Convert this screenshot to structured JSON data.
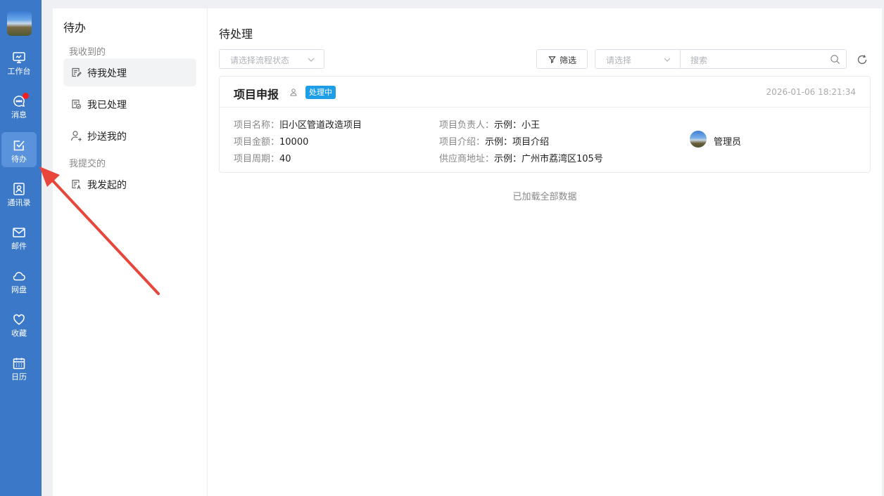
{
  "rail": {
    "items": [
      {
        "label": "工作台",
        "icon": "monitor-icon"
      },
      {
        "label": "消息",
        "icon": "chat-icon",
        "unread": true
      },
      {
        "label": "待办",
        "icon": "todo-check-icon",
        "active": true
      },
      {
        "label": "通讯录",
        "icon": "contacts-icon"
      },
      {
        "label": "邮件",
        "icon": "mail-icon"
      },
      {
        "label": "网盘",
        "icon": "cloud-icon"
      },
      {
        "label": "收藏",
        "icon": "heart-icon"
      },
      {
        "label": "日历",
        "icon": "calendar-icon"
      }
    ]
  },
  "panel": {
    "title": "待办",
    "group_received": "我收到的",
    "group_submitted": "我提交的",
    "items": [
      {
        "label": "待我处理",
        "icon": "pending-doc-icon",
        "active": true
      },
      {
        "label": "我已处理",
        "icon": "done-doc-icon"
      },
      {
        "label": "抄送我的",
        "icon": "cc-user-icon"
      },
      {
        "label": "我发起的",
        "icon": "initiated-doc-icon"
      }
    ]
  },
  "main": {
    "title": "待处理",
    "status_placeholder": "请选择流程状态",
    "filter_label": "筛选",
    "select_placeholder": "请选择",
    "search_placeholder": "搜索",
    "loaded_text": "已加载全部数据"
  },
  "card": {
    "title": "项目申报",
    "status_badge": "处理中",
    "time": "2026-01-06 18:21:34",
    "fields": [
      {
        "key": "项目名称：",
        "value": "旧小区管道改造项目"
      },
      {
        "key": "项目金额：",
        "value": "10000"
      },
      {
        "key": "项目周期：",
        "value": "40"
      },
      {
        "key": "项目负责人：",
        "value": "示例：小王"
      },
      {
        "key": "项目介绍：",
        "value": "示例：项目介绍"
      },
      {
        "key": "供应商地址：",
        "value": "示例：广州市荔湾区105号"
      }
    ],
    "assignee": "管理员"
  },
  "colors": {
    "rail_bg": "#3b78c8",
    "rail_active": "#5a93dc",
    "badge": "#1e9ee6",
    "annotation_arrow": "#e8463a"
  }
}
